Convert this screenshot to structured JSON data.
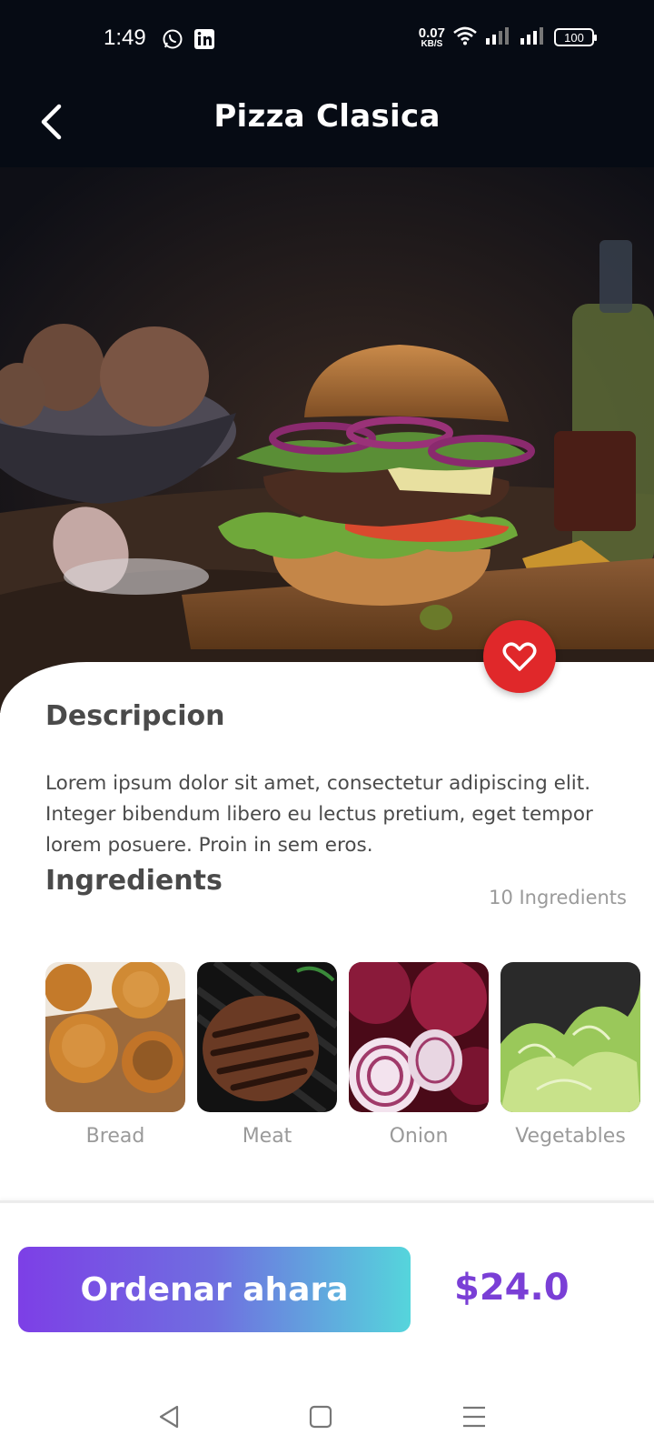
{
  "status_bar": {
    "time": "1:49",
    "net_speed_value": "0.07",
    "net_speed_unit": "KB/S",
    "battery": "100",
    "icons": [
      "whatsapp-icon",
      "linkedin-icon",
      "wifi-icon",
      "signal-icon",
      "signal-icon",
      "battery-icon"
    ]
  },
  "app_bar": {
    "title": "Pizza Clasica",
    "back_icon": "chevron-left-icon"
  },
  "hero": {
    "favorite_icon": "heart-icon"
  },
  "description": {
    "title": "Descripcion",
    "text": "Lorem ipsum dolor sit amet, consectetur adipiscing elit. Integer bibendum libero eu lectus pretium, eget tempor lorem posuere. Proin in sem eros."
  },
  "ingredients": {
    "title": "Ingredients",
    "count_label": "10 Ingredients",
    "items": [
      {
        "label": "Bread"
      },
      {
        "label": "Meat"
      },
      {
        "label": "Onion"
      },
      {
        "label": "Vegetables"
      }
    ]
  },
  "order": {
    "button_label": "Ordenar ahara",
    "price": "$24.0"
  },
  "nav_bar": {
    "icons": [
      "back-triangle-icon",
      "home-square-icon",
      "menu-lines-icon"
    ]
  },
  "colors": {
    "header_bg": "#060b14",
    "favorite": "#e0282a",
    "gradient_start": "#7d3fe6",
    "gradient_end": "#55d5dc",
    "price": "#7a3fd6"
  }
}
